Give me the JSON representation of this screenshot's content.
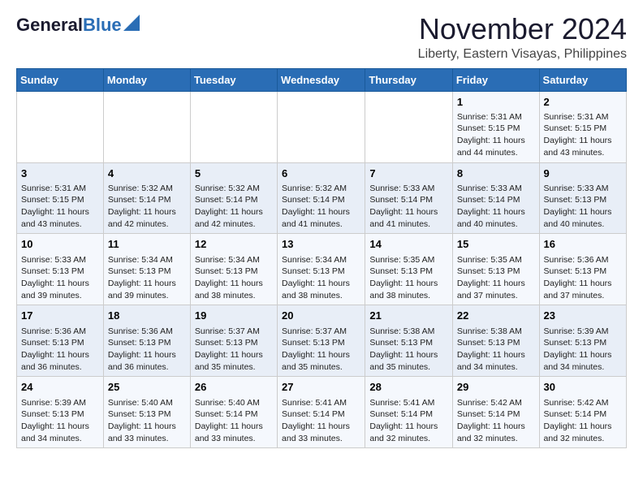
{
  "header": {
    "logo_general": "General",
    "logo_blue": "Blue",
    "month": "November 2024",
    "location": "Liberty, Eastern Visayas, Philippines"
  },
  "weekdays": [
    "Sunday",
    "Monday",
    "Tuesday",
    "Wednesday",
    "Thursday",
    "Friday",
    "Saturday"
  ],
  "weeks": [
    [
      {
        "day": "",
        "info": ""
      },
      {
        "day": "",
        "info": ""
      },
      {
        "day": "",
        "info": ""
      },
      {
        "day": "",
        "info": ""
      },
      {
        "day": "",
        "info": ""
      },
      {
        "day": "1",
        "info": "Sunrise: 5:31 AM\nSunset: 5:15 PM\nDaylight: 11 hours and 44 minutes."
      },
      {
        "day": "2",
        "info": "Sunrise: 5:31 AM\nSunset: 5:15 PM\nDaylight: 11 hours and 43 minutes."
      }
    ],
    [
      {
        "day": "3",
        "info": "Sunrise: 5:31 AM\nSunset: 5:15 PM\nDaylight: 11 hours and 43 minutes."
      },
      {
        "day": "4",
        "info": "Sunrise: 5:32 AM\nSunset: 5:14 PM\nDaylight: 11 hours and 42 minutes."
      },
      {
        "day": "5",
        "info": "Sunrise: 5:32 AM\nSunset: 5:14 PM\nDaylight: 11 hours and 42 minutes."
      },
      {
        "day": "6",
        "info": "Sunrise: 5:32 AM\nSunset: 5:14 PM\nDaylight: 11 hours and 41 minutes."
      },
      {
        "day": "7",
        "info": "Sunrise: 5:33 AM\nSunset: 5:14 PM\nDaylight: 11 hours and 41 minutes."
      },
      {
        "day": "8",
        "info": "Sunrise: 5:33 AM\nSunset: 5:14 PM\nDaylight: 11 hours and 40 minutes."
      },
      {
        "day": "9",
        "info": "Sunrise: 5:33 AM\nSunset: 5:13 PM\nDaylight: 11 hours and 40 minutes."
      }
    ],
    [
      {
        "day": "10",
        "info": "Sunrise: 5:33 AM\nSunset: 5:13 PM\nDaylight: 11 hours and 39 minutes."
      },
      {
        "day": "11",
        "info": "Sunrise: 5:34 AM\nSunset: 5:13 PM\nDaylight: 11 hours and 39 minutes."
      },
      {
        "day": "12",
        "info": "Sunrise: 5:34 AM\nSunset: 5:13 PM\nDaylight: 11 hours and 38 minutes."
      },
      {
        "day": "13",
        "info": "Sunrise: 5:34 AM\nSunset: 5:13 PM\nDaylight: 11 hours and 38 minutes."
      },
      {
        "day": "14",
        "info": "Sunrise: 5:35 AM\nSunset: 5:13 PM\nDaylight: 11 hours and 38 minutes."
      },
      {
        "day": "15",
        "info": "Sunrise: 5:35 AM\nSunset: 5:13 PM\nDaylight: 11 hours and 37 minutes."
      },
      {
        "day": "16",
        "info": "Sunrise: 5:36 AM\nSunset: 5:13 PM\nDaylight: 11 hours and 37 minutes."
      }
    ],
    [
      {
        "day": "17",
        "info": "Sunrise: 5:36 AM\nSunset: 5:13 PM\nDaylight: 11 hours and 36 minutes."
      },
      {
        "day": "18",
        "info": "Sunrise: 5:36 AM\nSunset: 5:13 PM\nDaylight: 11 hours and 36 minutes."
      },
      {
        "day": "19",
        "info": "Sunrise: 5:37 AM\nSunset: 5:13 PM\nDaylight: 11 hours and 35 minutes."
      },
      {
        "day": "20",
        "info": "Sunrise: 5:37 AM\nSunset: 5:13 PM\nDaylight: 11 hours and 35 minutes."
      },
      {
        "day": "21",
        "info": "Sunrise: 5:38 AM\nSunset: 5:13 PM\nDaylight: 11 hours and 35 minutes."
      },
      {
        "day": "22",
        "info": "Sunrise: 5:38 AM\nSunset: 5:13 PM\nDaylight: 11 hours and 34 minutes."
      },
      {
        "day": "23",
        "info": "Sunrise: 5:39 AM\nSunset: 5:13 PM\nDaylight: 11 hours and 34 minutes."
      }
    ],
    [
      {
        "day": "24",
        "info": "Sunrise: 5:39 AM\nSunset: 5:13 PM\nDaylight: 11 hours and 34 minutes."
      },
      {
        "day": "25",
        "info": "Sunrise: 5:40 AM\nSunset: 5:13 PM\nDaylight: 11 hours and 33 minutes."
      },
      {
        "day": "26",
        "info": "Sunrise: 5:40 AM\nSunset: 5:14 PM\nDaylight: 11 hours and 33 minutes."
      },
      {
        "day": "27",
        "info": "Sunrise: 5:41 AM\nSunset: 5:14 PM\nDaylight: 11 hours and 33 minutes."
      },
      {
        "day": "28",
        "info": "Sunrise: 5:41 AM\nSunset: 5:14 PM\nDaylight: 11 hours and 32 minutes."
      },
      {
        "day": "29",
        "info": "Sunrise: 5:42 AM\nSunset: 5:14 PM\nDaylight: 11 hours and 32 minutes."
      },
      {
        "day": "30",
        "info": "Sunrise: 5:42 AM\nSunset: 5:14 PM\nDaylight: 11 hours and 32 minutes."
      }
    ]
  ]
}
